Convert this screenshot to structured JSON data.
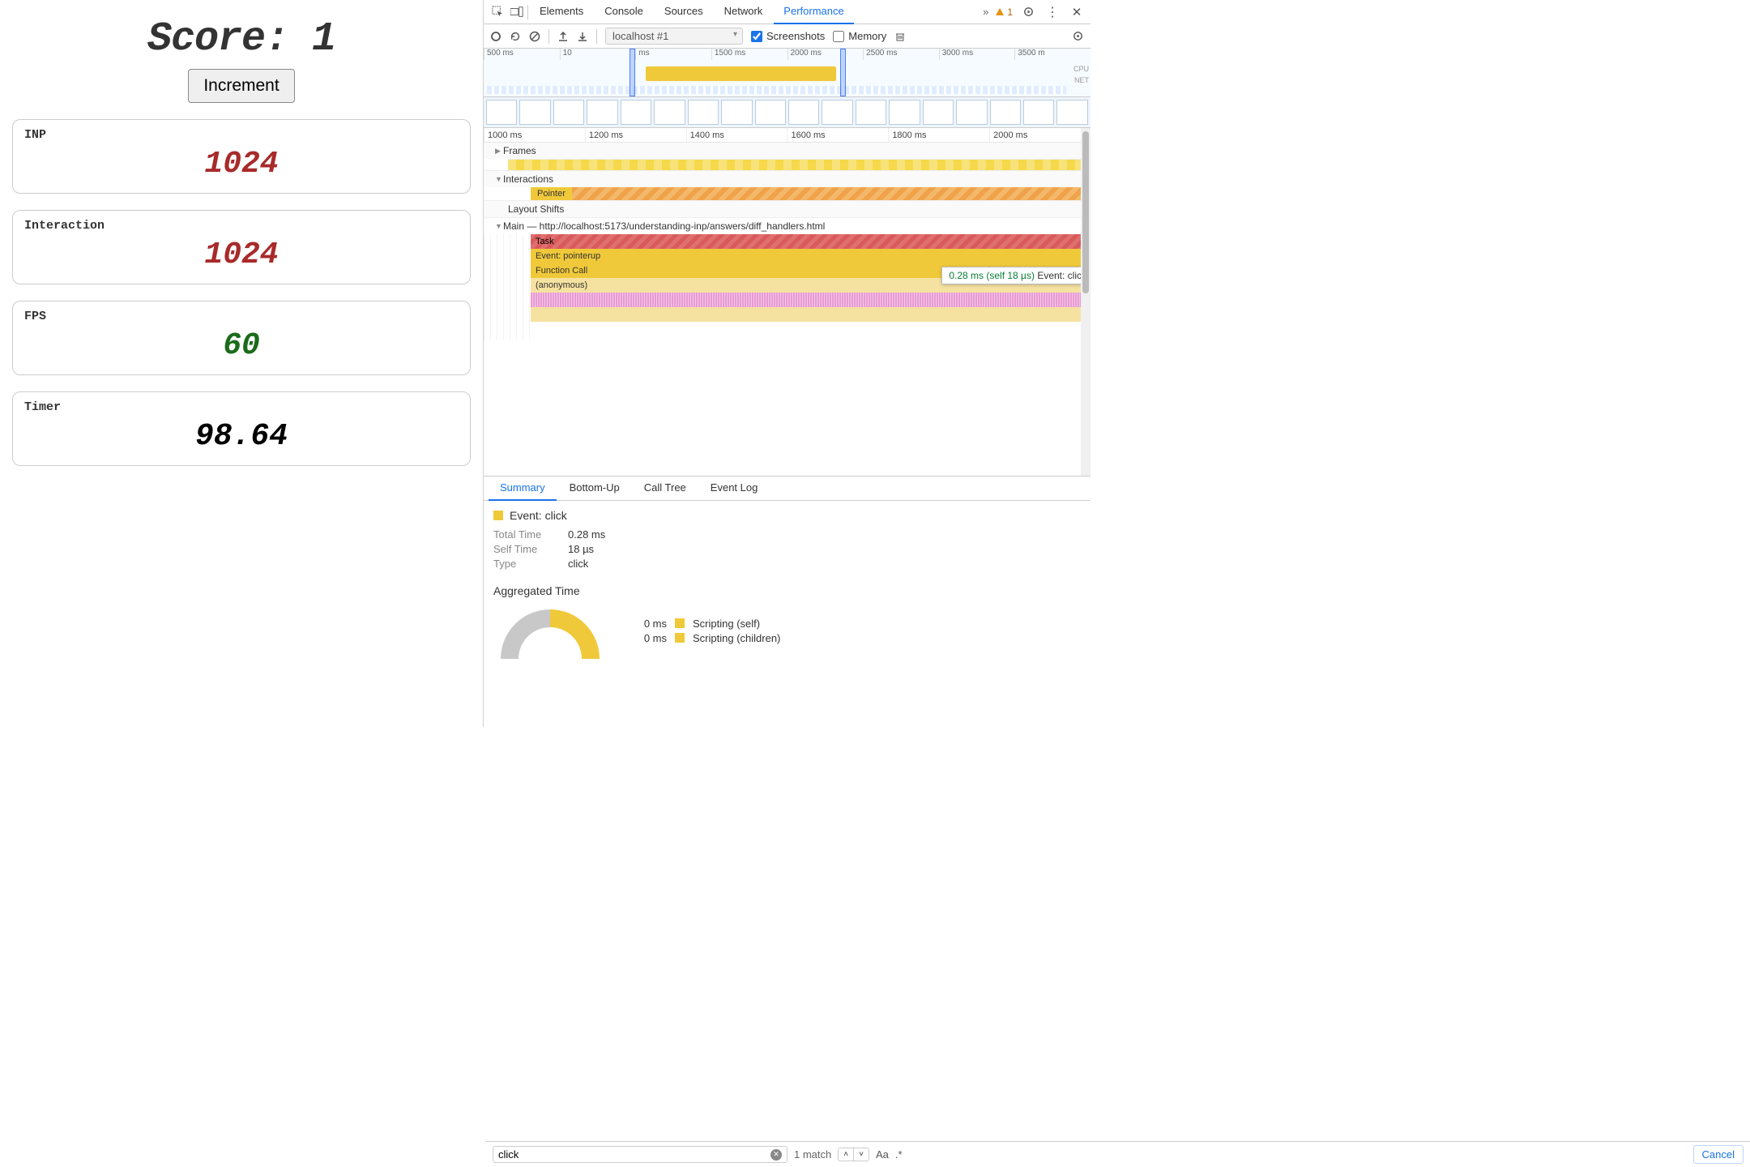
{
  "page": {
    "score_label": "Score: ",
    "score_value": "1",
    "increment_button": "Increment",
    "metrics": [
      {
        "label": "INP",
        "value": "1024",
        "color": "red"
      },
      {
        "label": "Interaction",
        "value": "1024",
        "color": "red"
      },
      {
        "label": "FPS",
        "value": "60",
        "color": "green"
      },
      {
        "label": "Timer",
        "value": "98.64",
        "color": "black"
      }
    ]
  },
  "devtools": {
    "tabs": [
      "Elements",
      "Console",
      "Sources",
      "Network",
      "Performance"
    ],
    "active_tab": "Performance",
    "more_indicator": "»",
    "warning_count": "1",
    "toolbar": {
      "context": "localhost #1",
      "screenshots_label": "Screenshots",
      "screenshots_checked": true,
      "memory_label": "Memory",
      "memory_checked": false
    },
    "overview_ticks": [
      "500 ms",
      "10",
      "ms",
      "1500 ms",
      "2000 ms",
      "2500 ms",
      "3000 ms",
      "3500 m"
    ],
    "overview_lanes": [
      "CPU",
      "NET"
    ],
    "ruler_ticks": [
      "1000 ms",
      "1200 ms",
      "1400 ms",
      "1600 ms",
      "1800 ms",
      "2000 ms"
    ],
    "sections": {
      "frames": "Frames",
      "interactions": "Interactions",
      "pointer": "Pointer",
      "layout_shifts": "Layout Shifts",
      "main_label": "Main — http://localhost:5173/understanding-inp/answers/diff_handlers.html"
    },
    "flame": {
      "task": "Task",
      "event_pointerup": "Event: pointerup",
      "function_call": "Function Call",
      "anonymous": "(anonymous)"
    },
    "hover_tooltip": {
      "timing": "0.28 ms (self 18 µs)",
      "name": "Event: click"
    },
    "detail_tabs": [
      "Summary",
      "Bottom-Up",
      "Call Tree",
      "Event Log"
    ],
    "active_detail_tab": "Summary",
    "summary": {
      "title": "Event: click",
      "rows": [
        {
          "k": "Total Time",
          "v": "0.28 ms"
        },
        {
          "k": "Self Time",
          "v": "18 µs"
        },
        {
          "k": "Type",
          "v": "click"
        }
      ],
      "aggregated_title": "Aggregated Time",
      "legend": [
        {
          "ms": "0 ms",
          "label": "Scripting (self)"
        },
        {
          "ms": "0 ms",
          "label": "Scripting (children)"
        }
      ]
    },
    "search": {
      "value": "click",
      "matches": "1 match",
      "cancel": "Cancel"
    }
  }
}
